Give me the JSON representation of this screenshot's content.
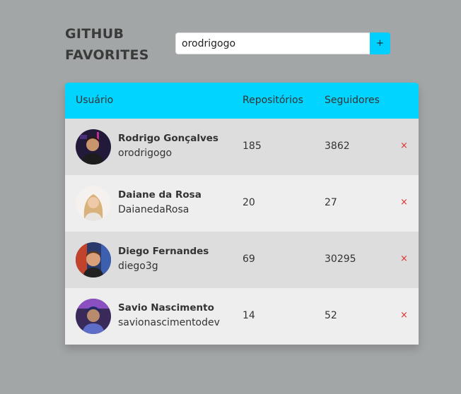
{
  "header": {
    "title_line1": "GITHUB",
    "title_line2": "FAVORITES"
  },
  "search": {
    "value": "orodrigogo",
    "button_label": "+"
  },
  "table": {
    "columns": [
      "Usuário",
      "Repositórios",
      "Seguidores"
    ],
    "remove_label": "×",
    "rows": [
      {
        "name": "Rodrigo Gonçalves",
        "login": "orodrigogo",
        "repos": "185",
        "followers": "3862"
      },
      {
        "name": "Daiane da Rosa",
        "login": "DaianedaRosa",
        "repos": "20",
        "followers": "27"
      },
      {
        "name": "Diego Fernandes",
        "login": "diego3g",
        "repos": "69",
        "followers": "30295"
      },
      {
        "name": "Savio Nascimento",
        "login": "savionascimentodev",
        "repos": "14",
        "followers": "52"
      }
    ]
  },
  "colors": {
    "background": "#a3a6a7",
    "accent": "#00d4ff",
    "remove": "#e22d2d"
  }
}
